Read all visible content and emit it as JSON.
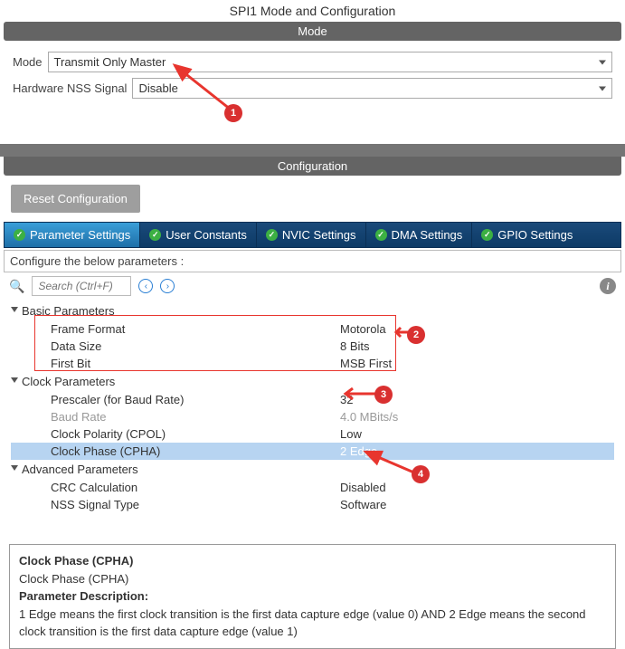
{
  "title": "SPI1 Mode and Configuration",
  "sections": {
    "mode": "Mode",
    "configuration": "Configuration"
  },
  "mode_form": {
    "mode_label": "Mode",
    "mode_value": "Transmit Only Master",
    "nss_label": "Hardware NSS Signal",
    "nss_value": "Disable"
  },
  "reset_button": "Reset Configuration",
  "tabs": {
    "parameter": "Parameter Settings",
    "user_constants": "User Constants",
    "nvic": "NVIC Settings",
    "dma": "DMA Settings",
    "gpio": "GPIO Settings"
  },
  "instruction": "Configure the below parameters :",
  "search": {
    "placeholder": "Search (Ctrl+F)"
  },
  "groups": {
    "basic": {
      "title": "Basic Parameters",
      "frame_format": {
        "label": "Frame Format",
        "value": "Motorola"
      },
      "data_size": {
        "label": "Data Size",
        "value": "8 Bits"
      },
      "first_bit": {
        "label": "First Bit",
        "value": "MSB First"
      }
    },
    "clock": {
      "title": "Clock Parameters",
      "prescaler": {
        "label": "Prescaler (for Baud Rate)",
        "value": "32"
      },
      "baud_rate": {
        "label": "Baud Rate",
        "value": "4.0 MBits/s"
      },
      "cpol": {
        "label": "Clock Polarity (CPOL)",
        "value": "Low"
      },
      "cpha": {
        "label": "Clock Phase (CPHA)",
        "value": "2 Edge"
      }
    },
    "advanced": {
      "title": "Advanced Parameters",
      "crc": {
        "label": "CRC Calculation",
        "value": "Disabled"
      },
      "nss_type": {
        "label": "NSS Signal Type",
        "value": "Software"
      }
    }
  },
  "description": {
    "heading": "Clock Phase (CPHA)",
    "sub": "Clock Phase (CPHA)",
    "desc_label": "Parameter Description:",
    "desc_text": "1 Edge means the first clock transition is the first data capture edge (value 0) AND 2 Edge means the second clock transition is the first data capture edge (value 1)"
  },
  "callouts": {
    "c1": "1",
    "c2": "2",
    "c3": "3",
    "c4": "4"
  }
}
